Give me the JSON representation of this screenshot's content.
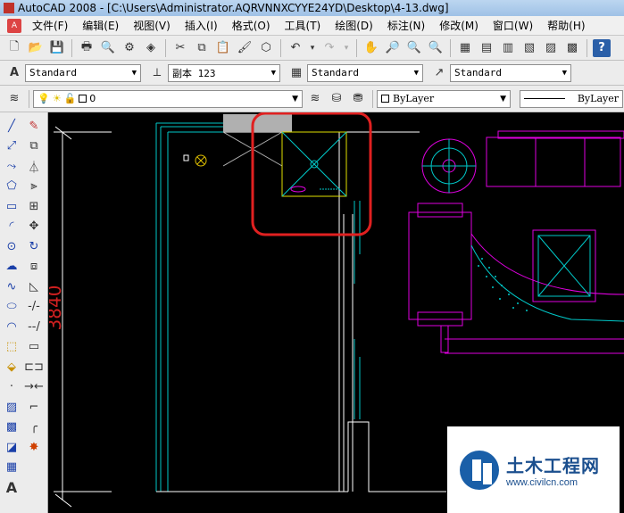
{
  "window": {
    "title": "AutoCAD 2008 - [C:\\Users\\Administrator.AQRVNNXCYYE24YD\\Desktop\\4-13.dwg]"
  },
  "menu": [
    "文件(F)",
    "编辑(E)",
    "视图(V)",
    "插入(I)",
    "格式(O)",
    "工具(T)",
    "绘图(D)",
    "标注(N)",
    "修改(M)",
    "窗口(W)",
    "帮助(H)"
  ],
  "styles": {
    "text_style": "Standard",
    "dim_style": "副本 123",
    "table_style": "Standard",
    "multileader_style": "Standard"
  },
  "layers": {
    "current_layer": "0",
    "color": "ByLayer",
    "linetype": "ByLayer"
  },
  "drawing": {
    "dimension_text": "3840",
    "colors": {
      "cyan": "#00c8c8",
      "magenta": "#e000e0",
      "white": "#ffffff",
      "red_mark": "#e02020",
      "yellow": "#e0e000",
      "dim_red": "#d02020"
    }
  },
  "watermark": {
    "title": "土木工程网",
    "url": "www.civilcn.com"
  }
}
